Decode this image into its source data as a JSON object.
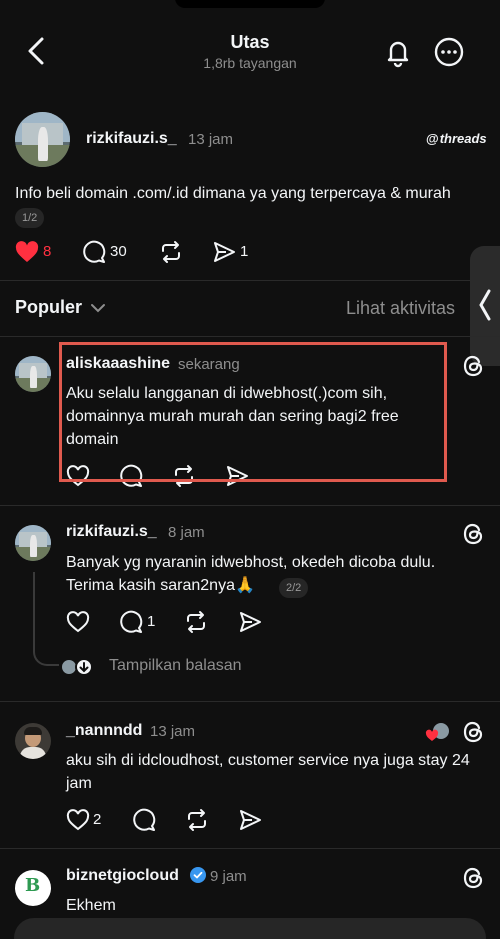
{
  "header": {
    "title": "Utas",
    "subtitle": "1,8rb tayangan"
  },
  "main_post": {
    "username": "rizkifauzi.s_",
    "time": "13 jam",
    "brand": "threads",
    "text": "Info beli domain .com/.id dimana ya yang terpercaya & murah",
    "page": "1/2",
    "likes": "8",
    "replies": "30",
    "shares": "1"
  },
  "filter": {
    "sort_label": "Populer",
    "activity_label": "Lihat aktivitas"
  },
  "replies": [
    {
      "username": "aliskaaashine",
      "time": "sekarang",
      "text": "Aku selalu langganan di idwebhost(.)com sih, domainnya murah murah dan sering bagi2 free domain"
    },
    {
      "username": "rizkifauzi.s_",
      "time": "8 jam",
      "text": "Banyak yg nyaranin idwebhost, okedeh dicoba dulu. Terima kasih saran2nya🙏",
      "page": "2/2",
      "replies": "1",
      "show_replies": "Tampilkan balasan"
    },
    {
      "username": "_nannndd",
      "time": "13 jam",
      "text": "aku sih di idcloudhost, customer service nya juga stay 24 jam",
      "likes": "2"
    },
    {
      "username": "biznetgiocloud",
      "time": "9 jam",
      "text": "Ekhem"
    }
  ],
  "colors": {
    "background": "#101010",
    "like_red": "#ff3040",
    "highlight_box": "#e05a4e",
    "verified_blue": "#3897f0"
  }
}
